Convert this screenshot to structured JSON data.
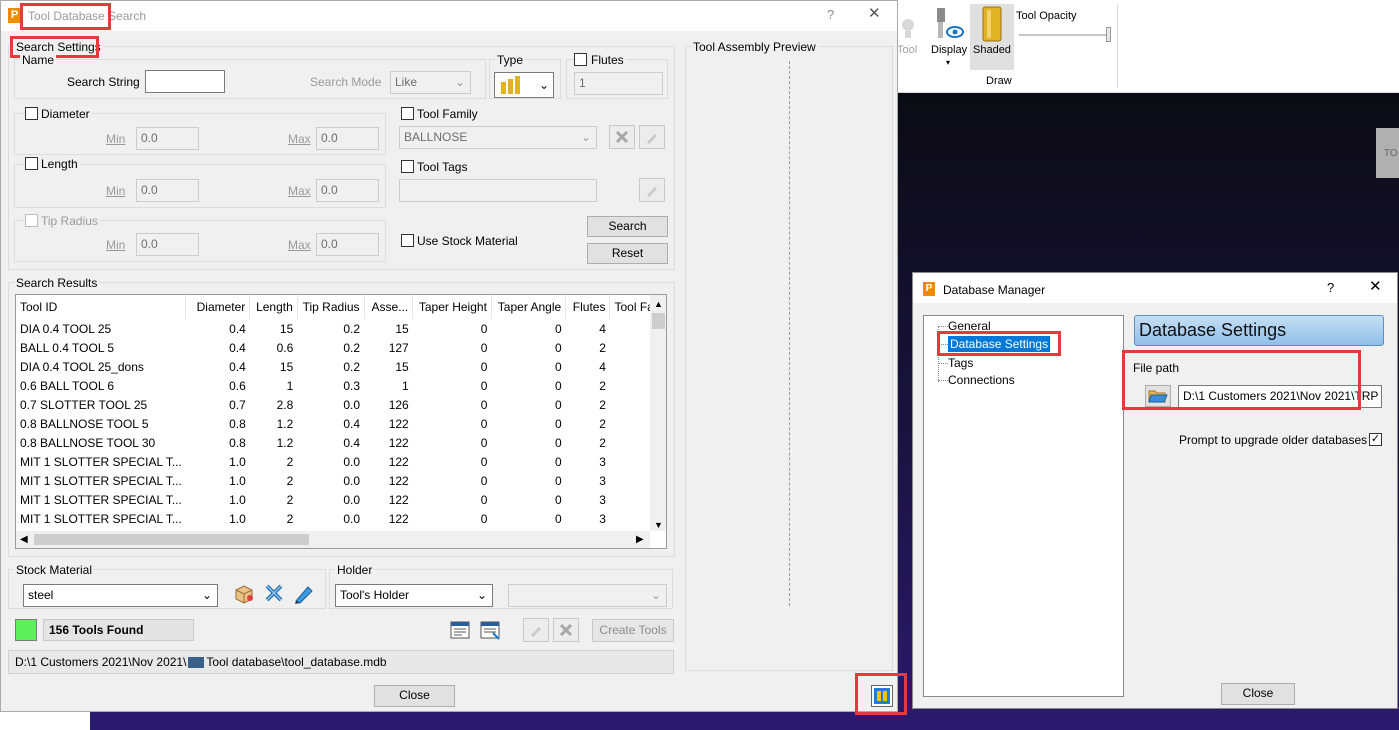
{
  "background_app": {
    "ribbon": {
      "tool_label": "Tool",
      "display_label": "Display",
      "shaded_label": "Shaded",
      "tool_opacity_label": "Tool Opacity",
      "group_label": "Draw"
    },
    "side_tab_text": "TO"
  },
  "tool_db_search": {
    "title": "Tool Database Search",
    "help_label": "?",
    "close_x": "✕",
    "search_settings_title": "Search Settings",
    "name_title": "Name",
    "search_string_label": "Search String",
    "search_string_value": "",
    "search_mode_label": "Search Mode",
    "search_mode_value": "Like",
    "type_title": "Type",
    "flutes_label": "Flutes",
    "flutes_value": "1",
    "diameter_label": "Diameter",
    "length_label": "Length",
    "tip_radius_label": "Tip Radius",
    "min_label": "Min",
    "max_label": "Max",
    "diameter_min": "0.0",
    "diameter_max": "0.0",
    "length_min": "0.0",
    "length_max": "0.0",
    "tip_min": "0.0",
    "tip_max": "0.0",
    "tool_family_label": "Tool Family",
    "tool_family_value": "BALLNOSE",
    "tool_tags_label": "Tool Tags",
    "tool_tags_value": "",
    "use_stock_material_label": "Use Stock Material",
    "search_button": "Search",
    "reset_button": "Reset",
    "search_results_title": "Search Results",
    "columns": [
      "Tool ID",
      "Diameter",
      "Length",
      "Tip Radius",
      "Asse...",
      "Taper Height",
      "Taper Angle",
      "Flutes",
      "Tool Far"
    ],
    "rows": [
      [
        "DIA 0.4 TOOL 25",
        "0.4",
        "15",
        "0.2",
        "15",
        "0",
        "0",
        "4",
        ""
      ],
      [
        "BALL 0.4       TOOL 5",
        "0.4",
        "0.6",
        "0.2",
        "127",
        "0",
        "0",
        "2",
        ""
      ],
      [
        "DIA 0.4 TOOL 25_dons",
        "0.4",
        "15",
        "0.2",
        "15",
        "0",
        "0",
        "4",
        ""
      ],
      [
        "0.6 BALL      TOOL 6",
        "0.6",
        "1",
        "0.3",
        "1",
        "0",
        "0",
        "2",
        ""
      ],
      [
        "0.7 SLOTTER    TOOL 25",
        "0.7",
        "2.8",
        "0.0",
        "126",
        "0",
        "0",
        "2",
        ""
      ],
      [
        "0.8 BALLNOSE    TOOL 5",
        "0.8",
        "1.2",
        "0.4",
        "122",
        "0",
        "0",
        "2",
        ""
      ],
      [
        "0.8 BALLNOSE    TOOL 30",
        "0.8",
        "1.2",
        "0.4",
        "122",
        "0",
        "0",
        "2",
        ""
      ],
      [
        "MIT 1 SLOTTER SPECIAL T...",
        "1.0",
        "2",
        "0.0",
        "122",
        "0",
        "0",
        "3",
        ""
      ],
      [
        "MIT 1 SLOTTER SPECIAL T...",
        "1.0",
        "2",
        "0.0",
        "122",
        "0",
        "0",
        "3",
        ""
      ],
      [
        "MIT 1 SLOTTER SPECIAL T...",
        "1.0",
        "2",
        "0.0",
        "122",
        "0",
        "0",
        "3",
        ""
      ],
      [
        "MIT 1 SLOTTER SPECIAL T...",
        "1.0",
        "2",
        "0.0",
        "122",
        "0",
        "0",
        "3",
        ""
      ]
    ],
    "stock_material_title": "Stock Material",
    "stock_material_value": "steel",
    "holder_title": "Holder",
    "holder_value": "Tool's Holder",
    "holder_secondary_value": "",
    "tools_found": "156 Tools Found",
    "create_tools_button": "Create Tools",
    "path_text": "D:\\1 Customers 2021\\Nov 2021\\",
    "path_text_tail": "Tool database\\tool_database.mdb",
    "close_button": "Close",
    "preview_title": "Tool Assembly Preview"
  },
  "database_manager": {
    "title": "Database Manager",
    "help_label": "?",
    "close_x": "✕",
    "tree": [
      "General",
      "Database Settings",
      "Tags",
      "Connections"
    ],
    "panel_header": "Database Settings",
    "file_path_label": "File path",
    "file_path_value": "D:\\1 Customers 2021\\Nov 2021\\TRP",
    "prompt_upgrade_label": "Prompt to upgrade older databases",
    "close_button": "Close"
  },
  "colors": {
    "highlight": "#e33b3b",
    "found_indicator": "#5cf05c",
    "selection": "#0078d7",
    "viewport_top": "#0b0b12",
    "viewport_bottom": "#2a1a6e"
  }
}
